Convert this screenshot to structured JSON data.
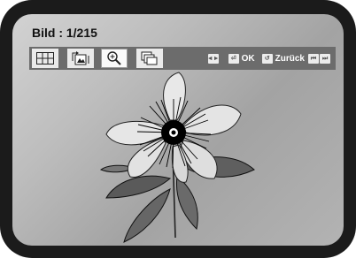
{
  "header": {
    "title": "Bild : 1/215"
  },
  "toolbar": {
    "buttons": [
      {
        "icon": "thumbnail-grid-icon"
      },
      {
        "icon": "rotate-icon"
      },
      {
        "icon": "zoom-icon"
      },
      {
        "icon": "slideshow-icon"
      }
    ],
    "hints": {
      "move_icon": "left-right-arrows-icon",
      "ok_icon": "enter-icon",
      "ok_label": "OK",
      "back_icon": "return-icon",
      "back_label": "Zurück",
      "page_icon": "skip-prev-next-icon"
    }
  },
  "colors": {
    "bezel": "#1b1b1b",
    "toolbar": "#6c6c6c"
  }
}
